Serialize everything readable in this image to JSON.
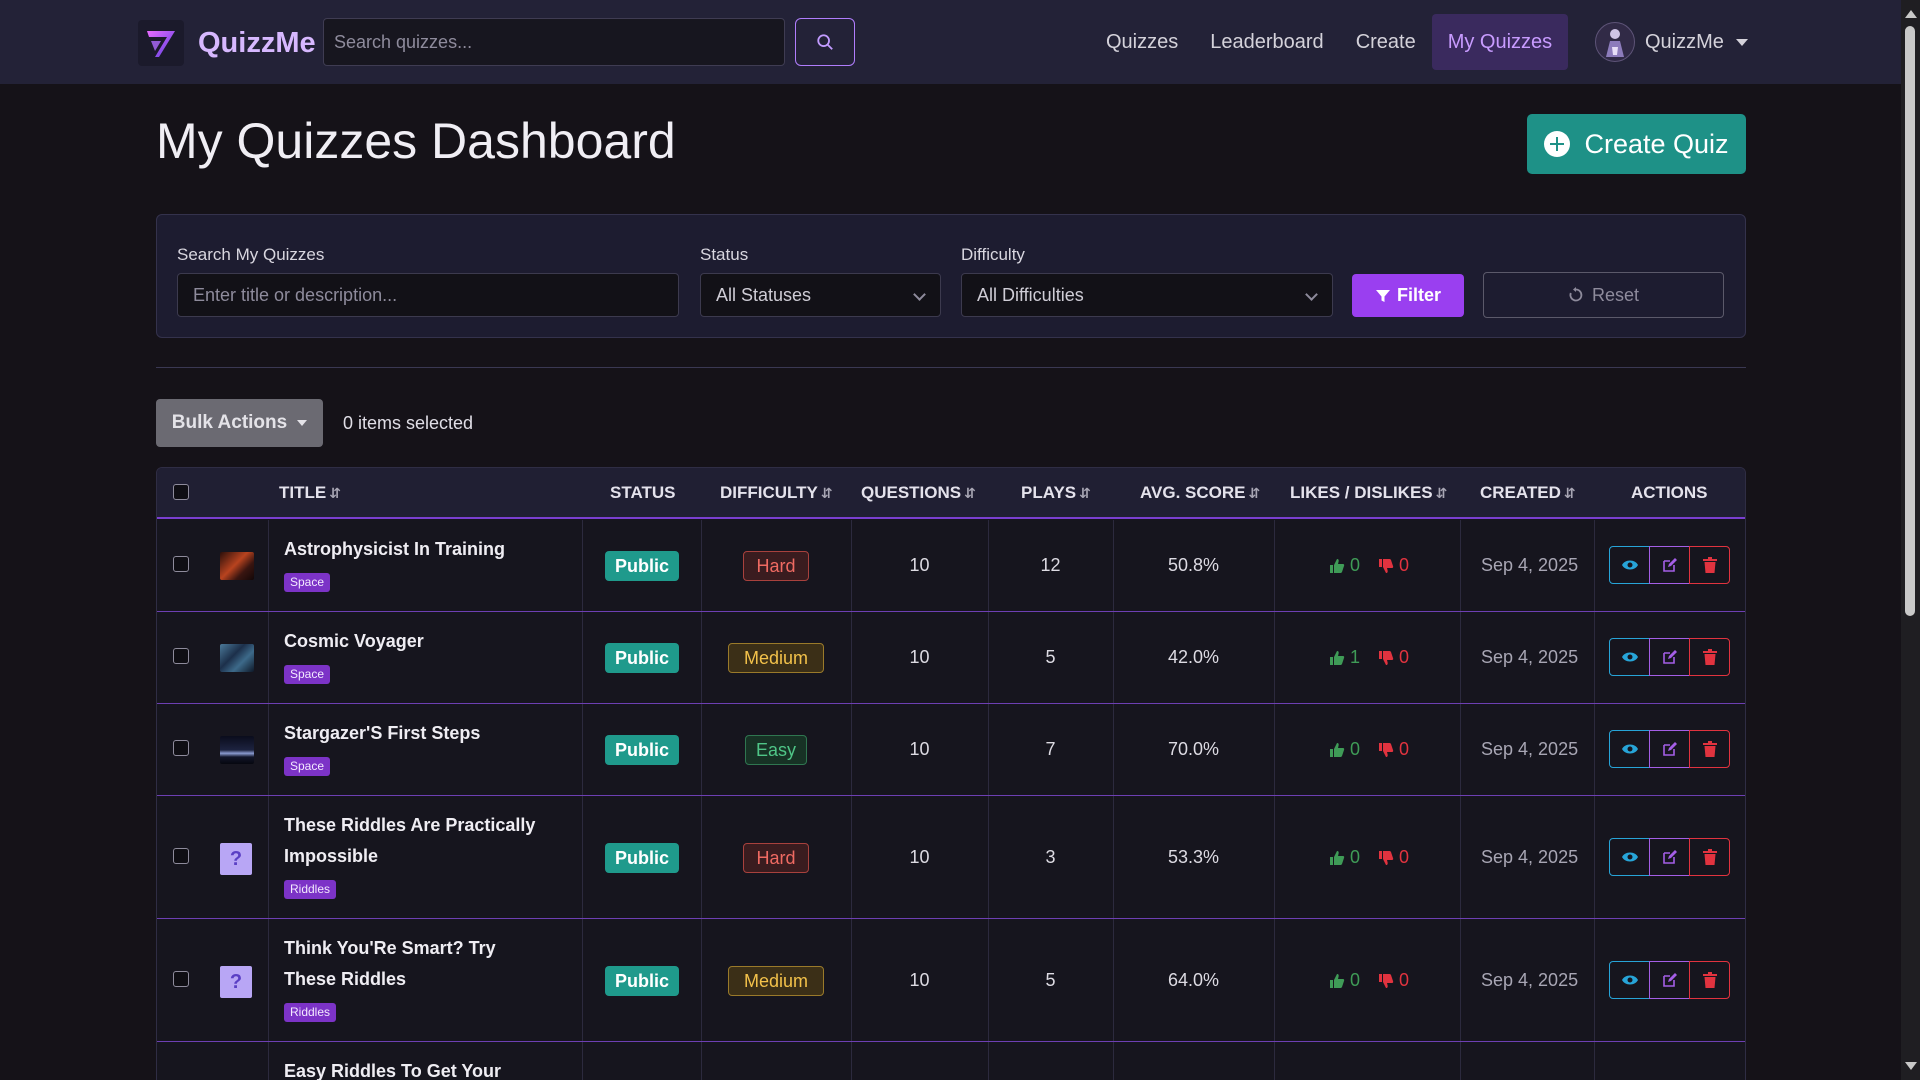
{
  "nav": {
    "brand": "QuizzMe",
    "search_placeholder": "Search quizzes...",
    "links": [
      "Quizzes",
      "Leaderboard",
      "Create",
      "My Quizzes"
    ],
    "active_link": "My Quizzes",
    "user": "QuizzMe"
  },
  "page": {
    "title": "My Quizzes Dashboard",
    "create_button": "Create Quiz"
  },
  "filters": {
    "search_label": "Search My Quizzes",
    "search_placeholder": "Enter title or description...",
    "status_label": "Status",
    "status_value": "All Statuses",
    "difficulty_label": "Difficulty",
    "difficulty_value": "All Difficulties",
    "filter_button": "Filter",
    "reset_button": "Reset"
  },
  "bulk": {
    "button": "Bulk Actions",
    "selected_text": "0 items selected"
  },
  "table": {
    "headers": {
      "title": "Title",
      "status": "Status",
      "difficulty": "Difficulty",
      "questions": "Questions",
      "plays": "Plays",
      "avg_score": "Avg. Score",
      "likes": "Likes / Dislikes",
      "created": "Created",
      "actions": "Actions"
    },
    "sort_icon": "⇵",
    "rows": [
      {
        "title": "Astrophysicist In Training",
        "tag": "Space",
        "status": "Public",
        "difficulty": "Hard",
        "questions": "10",
        "plays": "12",
        "avg_score": "50.8%",
        "likes": "0",
        "dislikes": "0",
        "created": "Sep 4, 2025",
        "thumb": "space-red"
      },
      {
        "title": "Cosmic Voyager",
        "tag": "Space",
        "status": "Public",
        "difficulty": "Medium",
        "questions": "10",
        "plays": "5",
        "avg_score": "42.0%",
        "likes": "1",
        "dislikes": "0",
        "created": "Sep 4, 2025",
        "thumb": "space-blue"
      },
      {
        "title": "Stargazer'S First Steps",
        "tag": "Space",
        "status": "Public",
        "difficulty": "Easy",
        "questions": "10",
        "plays": "7",
        "avg_score": "70.0%",
        "likes": "0",
        "dislikes": "0",
        "created": "Sep 4, 2025",
        "thumb": "space-night"
      },
      {
        "title": "These Riddles Are Practically Impossible",
        "tag": "Riddles",
        "status": "Public",
        "difficulty": "Hard",
        "questions": "10",
        "plays": "3",
        "avg_score": "53.3%",
        "likes": "0",
        "dislikes": "0",
        "created": "Sep 4, 2025",
        "thumb": "question"
      },
      {
        "title": "Think You'Re Smart? Try These Riddles",
        "tag": "Riddles",
        "status": "Public",
        "difficulty": "Medium",
        "questions": "10",
        "plays": "5",
        "avg_score": "64.0%",
        "likes": "0",
        "dislikes": "0",
        "created": "Sep 4, 2025",
        "thumb": "question"
      },
      {
        "title": "Easy Riddles To Get Your Brain"
      }
    ]
  },
  "colors": {
    "accent": "#9a3ff0",
    "public": "#1f9a8c",
    "hard": "#ef6a62",
    "medium": "#f2c14a",
    "easy": "#4fc587",
    "like": "#3f9b57",
    "dislike": "#e1333f"
  },
  "icons": [
    "search-icon",
    "plus-circle-icon",
    "filter-icon",
    "reset-icon",
    "checkbox-icon",
    "eye-icon",
    "edit-icon",
    "trash-icon",
    "thumbs-up-icon",
    "thumbs-down-icon",
    "caret-down-icon"
  ]
}
